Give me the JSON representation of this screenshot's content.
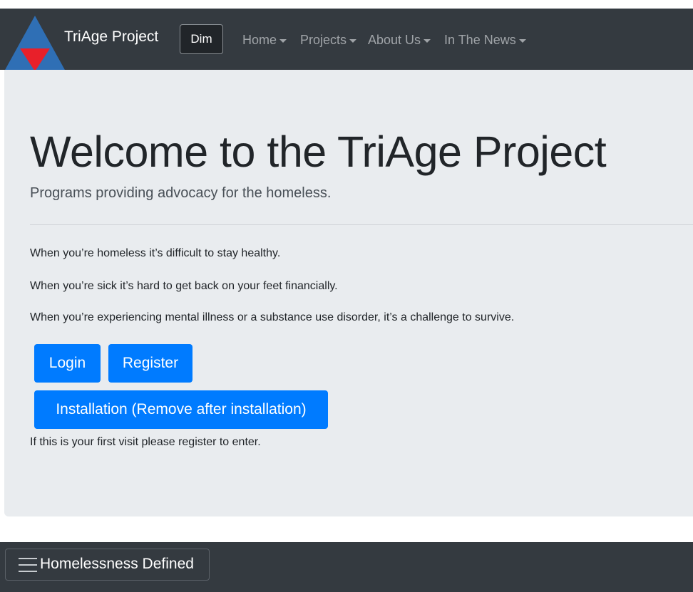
{
  "navbar": {
    "brand": "TriAge Project",
    "theme_button": "Dim",
    "items": [
      {
        "label": "Home"
      },
      {
        "label": "Projects"
      },
      {
        "label": "About Us"
      },
      {
        "label": "In The News"
      }
    ]
  },
  "hero": {
    "title": "Welcome to the TriAge Project",
    "lead": "Programs providing advocacy for the homeless.",
    "paragraphs": [
      "When you’re homeless it’s difficult to stay healthy.",
      "When you’re sick it’s hard to get back on your feet financially.",
      "When you’re experiencing mental illness or a substance use disorder, it’s a challenge to survive."
    ],
    "buttons": {
      "login": "Login",
      "register": "Register",
      "installation": "Installation (Remove after installation)"
    },
    "note": "If this is your first visit please register to enter."
  },
  "footer": {
    "toggle_label": "Homelessness Defined"
  },
  "colors": {
    "navbar": "#343a40",
    "jumbotron": "#e9ecef",
    "primary": "#007bff",
    "logo_blue": "#2f6fb5",
    "logo_red": "#e8202a"
  },
  "icons": {
    "logo": "triangle-logo-icon",
    "caret": "caret-down-icon",
    "menu": "hamburger-menu-icon"
  }
}
